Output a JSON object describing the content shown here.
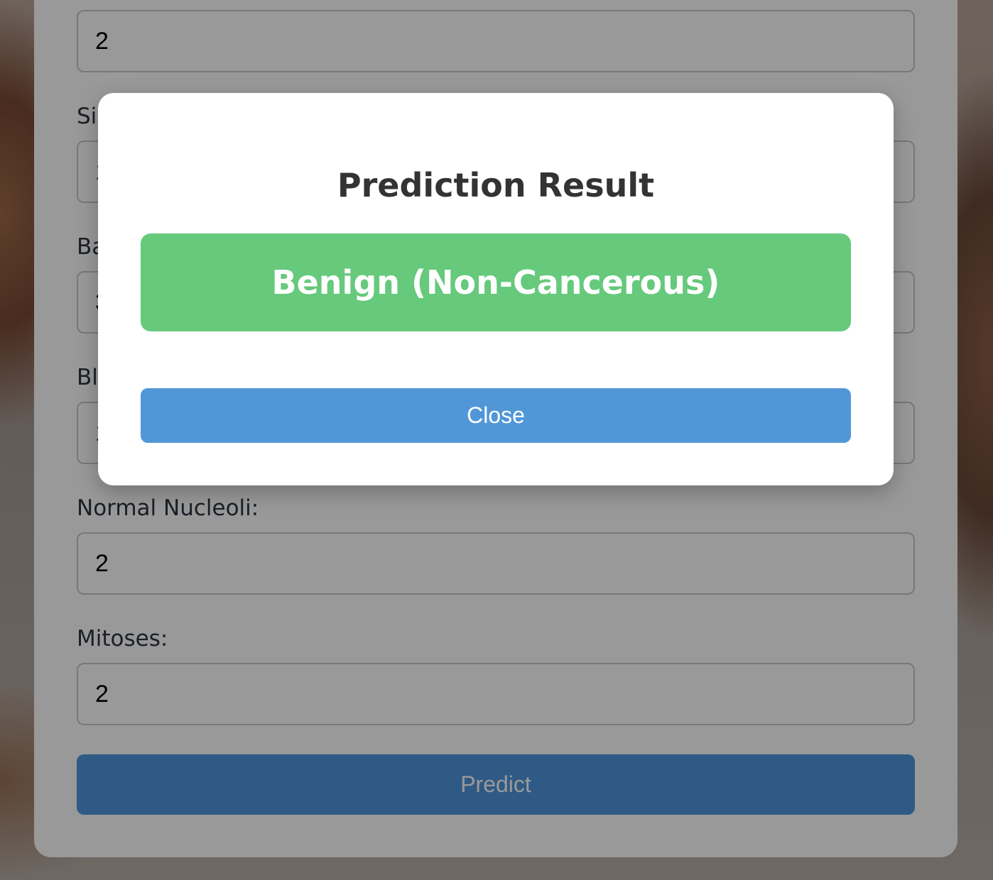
{
  "form": {
    "fields": [
      {
        "label": "",
        "value": "2"
      },
      {
        "label": "Si",
        "value": "1"
      },
      {
        "label": "Ba",
        "value": "3"
      },
      {
        "label": "Bl",
        "value": "1"
      },
      {
        "label": "Normal Nucleoli:",
        "value": "2"
      },
      {
        "label": "Mitoses:",
        "value": "2"
      }
    ],
    "predict_label": "Predict"
  },
  "modal": {
    "title": "Prediction Result",
    "result": "Benign (Non-Cancerous)",
    "result_color": "#66c97b",
    "close_label": "Close",
    "close_color": "#5197d8"
  }
}
